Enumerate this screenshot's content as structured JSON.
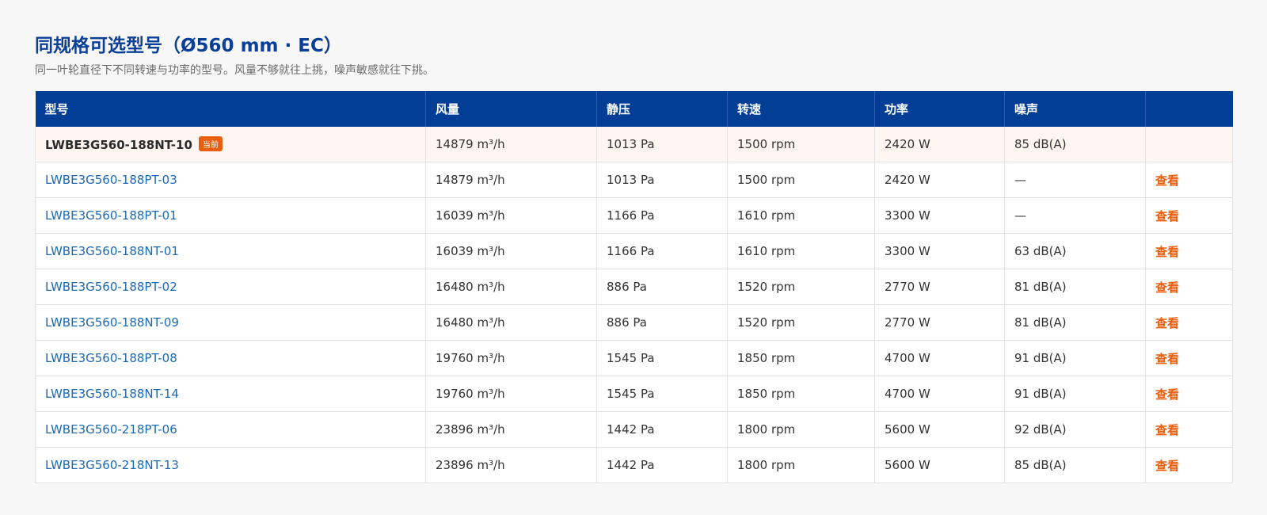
{
  "heading": {
    "title": "同规格可选型号（Ø560 mm · EC）",
    "subtitle": "同一叶轮直径下不同转速与功率的型号。风量不够就往上挑，噪声敏感就往下挑。"
  },
  "table": {
    "headers": [
      "型号",
      "风量",
      "静压",
      "转速",
      "功率",
      "噪声",
      ""
    ],
    "current_badge": "当前",
    "view_label": "查看",
    "rows": [
      {
        "model": "LWBE3G560-188NT-10",
        "airflow": "14879 m³/h",
        "pressure": "1013 Pa",
        "speed": "1500 rpm",
        "power": "2420 W",
        "noise": "85 dB(A)",
        "current": true
      },
      {
        "model": "LWBE3G560-188PT-03",
        "airflow": "14879 m³/h",
        "pressure": "1013 Pa",
        "speed": "1500 rpm",
        "power": "2420 W",
        "noise": "—"
      },
      {
        "model": "LWBE3G560-188PT-01",
        "airflow": "16039 m³/h",
        "pressure": "1166 Pa",
        "speed": "1610 rpm",
        "power": "3300 W",
        "noise": "—"
      },
      {
        "model": "LWBE3G560-188NT-01",
        "airflow": "16039 m³/h",
        "pressure": "1166 Pa",
        "speed": "1610 rpm",
        "power": "3300 W",
        "noise": "63 dB(A)"
      },
      {
        "model": "LWBE3G560-188PT-02",
        "airflow": "16480 m³/h",
        "pressure": "886 Pa",
        "speed": "1520 rpm",
        "power": "2770 W",
        "noise": "81 dB(A)"
      },
      {
        "model": "LWBE3G560-188NT-09",
        "airflow": "16480 m³/h",
        "pressure": "886 Pa",
        "speed": "1520 rpm",
        "power": "2770 W",
        "noise": "81 dB(A)"
      },
      {
        "model": "LWBE3G560-188PT-08",
        "airflow": "19760 m³/h",
        "pressure": "1545 Pa",
        "speed": "1850 rpm",
        "power": "4700 W",
        "noise": "91 dB(A)"
      },
      {
        "model": "LWBE3G560-188NT-14",
        "airflow": "19760 m³/h",
        "pressure": "1545 Pa",
        "speed": "1850 rpm",
        "power": "4700 W",
        "noise": "91 dB(A)"
      },
      {
        "model": "LWBE3G560-218PT-06",
        "airflow": "23896 m³/h",
        "pressure": "1442 Pa",
        "speed": "1800 rpm",
        "power": "5600 W",
        "noise": "92 dB(A)"
      },
      {
        "model": "LWBE3G560-218NT-13",
        "airflow": "23896 m³/h",
        "pressure": "1442 Pa",
        "speed": "1800 rpm",
        "power": "5600 W",
        "noise": "85 dB(A)"
      }
    ]
  },
  "colors": {
    "header_bg": "#023d96",
    "title": "#0a3f97",
    "link": "#1b68b3",
    "accent": "#e8600f",
    "current_row_bg": "#fff6f2"
  }
}
